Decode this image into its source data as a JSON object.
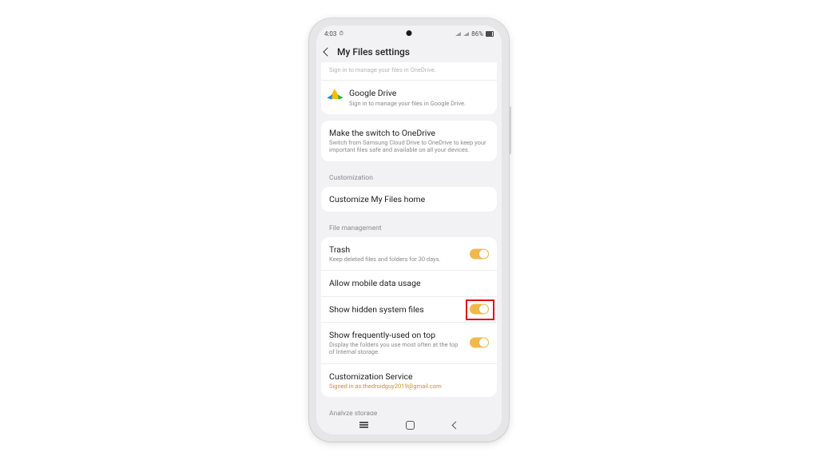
{
  "status": {
    "time": "4:03",
    "battery_text": "86%"
  },
  "header": {
    "title": "My Files settings"
  },
  "cloud_card": {
    "partial_row_text": "Sign in to manage your files in OneDrive.",
    "gdrive": {
      "title": "Google Drive",
      "sub": "Sign in to manage your files in Google Drive."
    }
  },
  "onedrive_card": {
    "title": "Make the switch to OneDrive",
    "sub": "Switch from Samsung Cloud Drive to OneDrive to keep your important files safe and available on all your devices."
  },
  "customization": {
    "section": "Customization",
    "customize_home": "Customize My Files home"
  },
  "file_mgmt": {
    "section": "File management",
    "trash": {
      "title": "Trash",
      "sub": "Keep deleted files and folders for 30 days.",
      "on": true
    },
    "mobile_data": "Allow mobile data usage",
    "hidden": {
      "title": "Show hidden system files",
      "on": true
    },
    "freq": {
      "title": "Show frequently-used on top",
      "sub": "Display the folders you use most often at the top of Internal storage.",
      "on": true
    },
    "cust_service": {
      "title": "Customization Service",
      "sub": "Signed in as thedroidguy2019@gmail.com"
    }
  },
  "analyze": {
    "section": "Analyze storage"
  }
}
